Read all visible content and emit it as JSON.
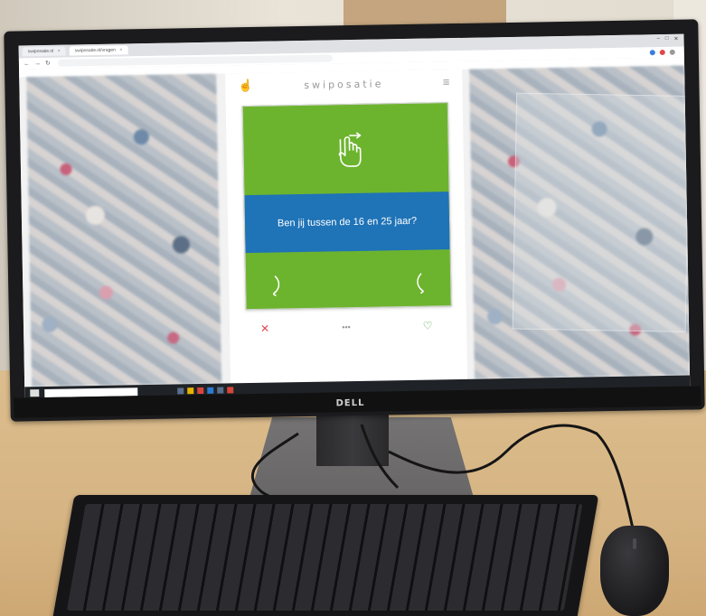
{
  "browser": {
    "tabs": [
      {
        "label": "swiposatie.nl",
        "active": false
      },
      {
        "label": "swiposatie.nl/vragen",
        "active": true
      }
    ],
    "url": "",
    "bookmarks": [],
    "nav": {
      "back": "←",
      "forward": "→",
      "reload": "↻"
    },
    "window_controls": {
      "minimize": "–",
      "maximize": "□",
      "close": "✕"
    },
    "extension_colors": [
      "#3b7ddd",
      "#e04848",
      "#9a9a9a"
    ]
  },
  "app": {
    "brand": "swiposatie",
    "menu_glyph": "≡",
    "hand_glyph": "☝",
    "card": {
      "counter": "",
      "question": "Ben jij tussen de 16 en 25 jaar?",
      "colors": {
        "top": "#6cb42e",
        "band": "#1f73b7",
        "text": "#ffffff"
      }
    },
    "actions": {
      "no_glyph": "✕",
      "skip_glyph": "•••",
      "yes_glyph": "♡"
    }
  },
  "taskbar": {
    "search_placeholder": "",
    "tray_text": ""
  },
  "hardware": {
    "monitor_brand": "DELL"
  }
}
